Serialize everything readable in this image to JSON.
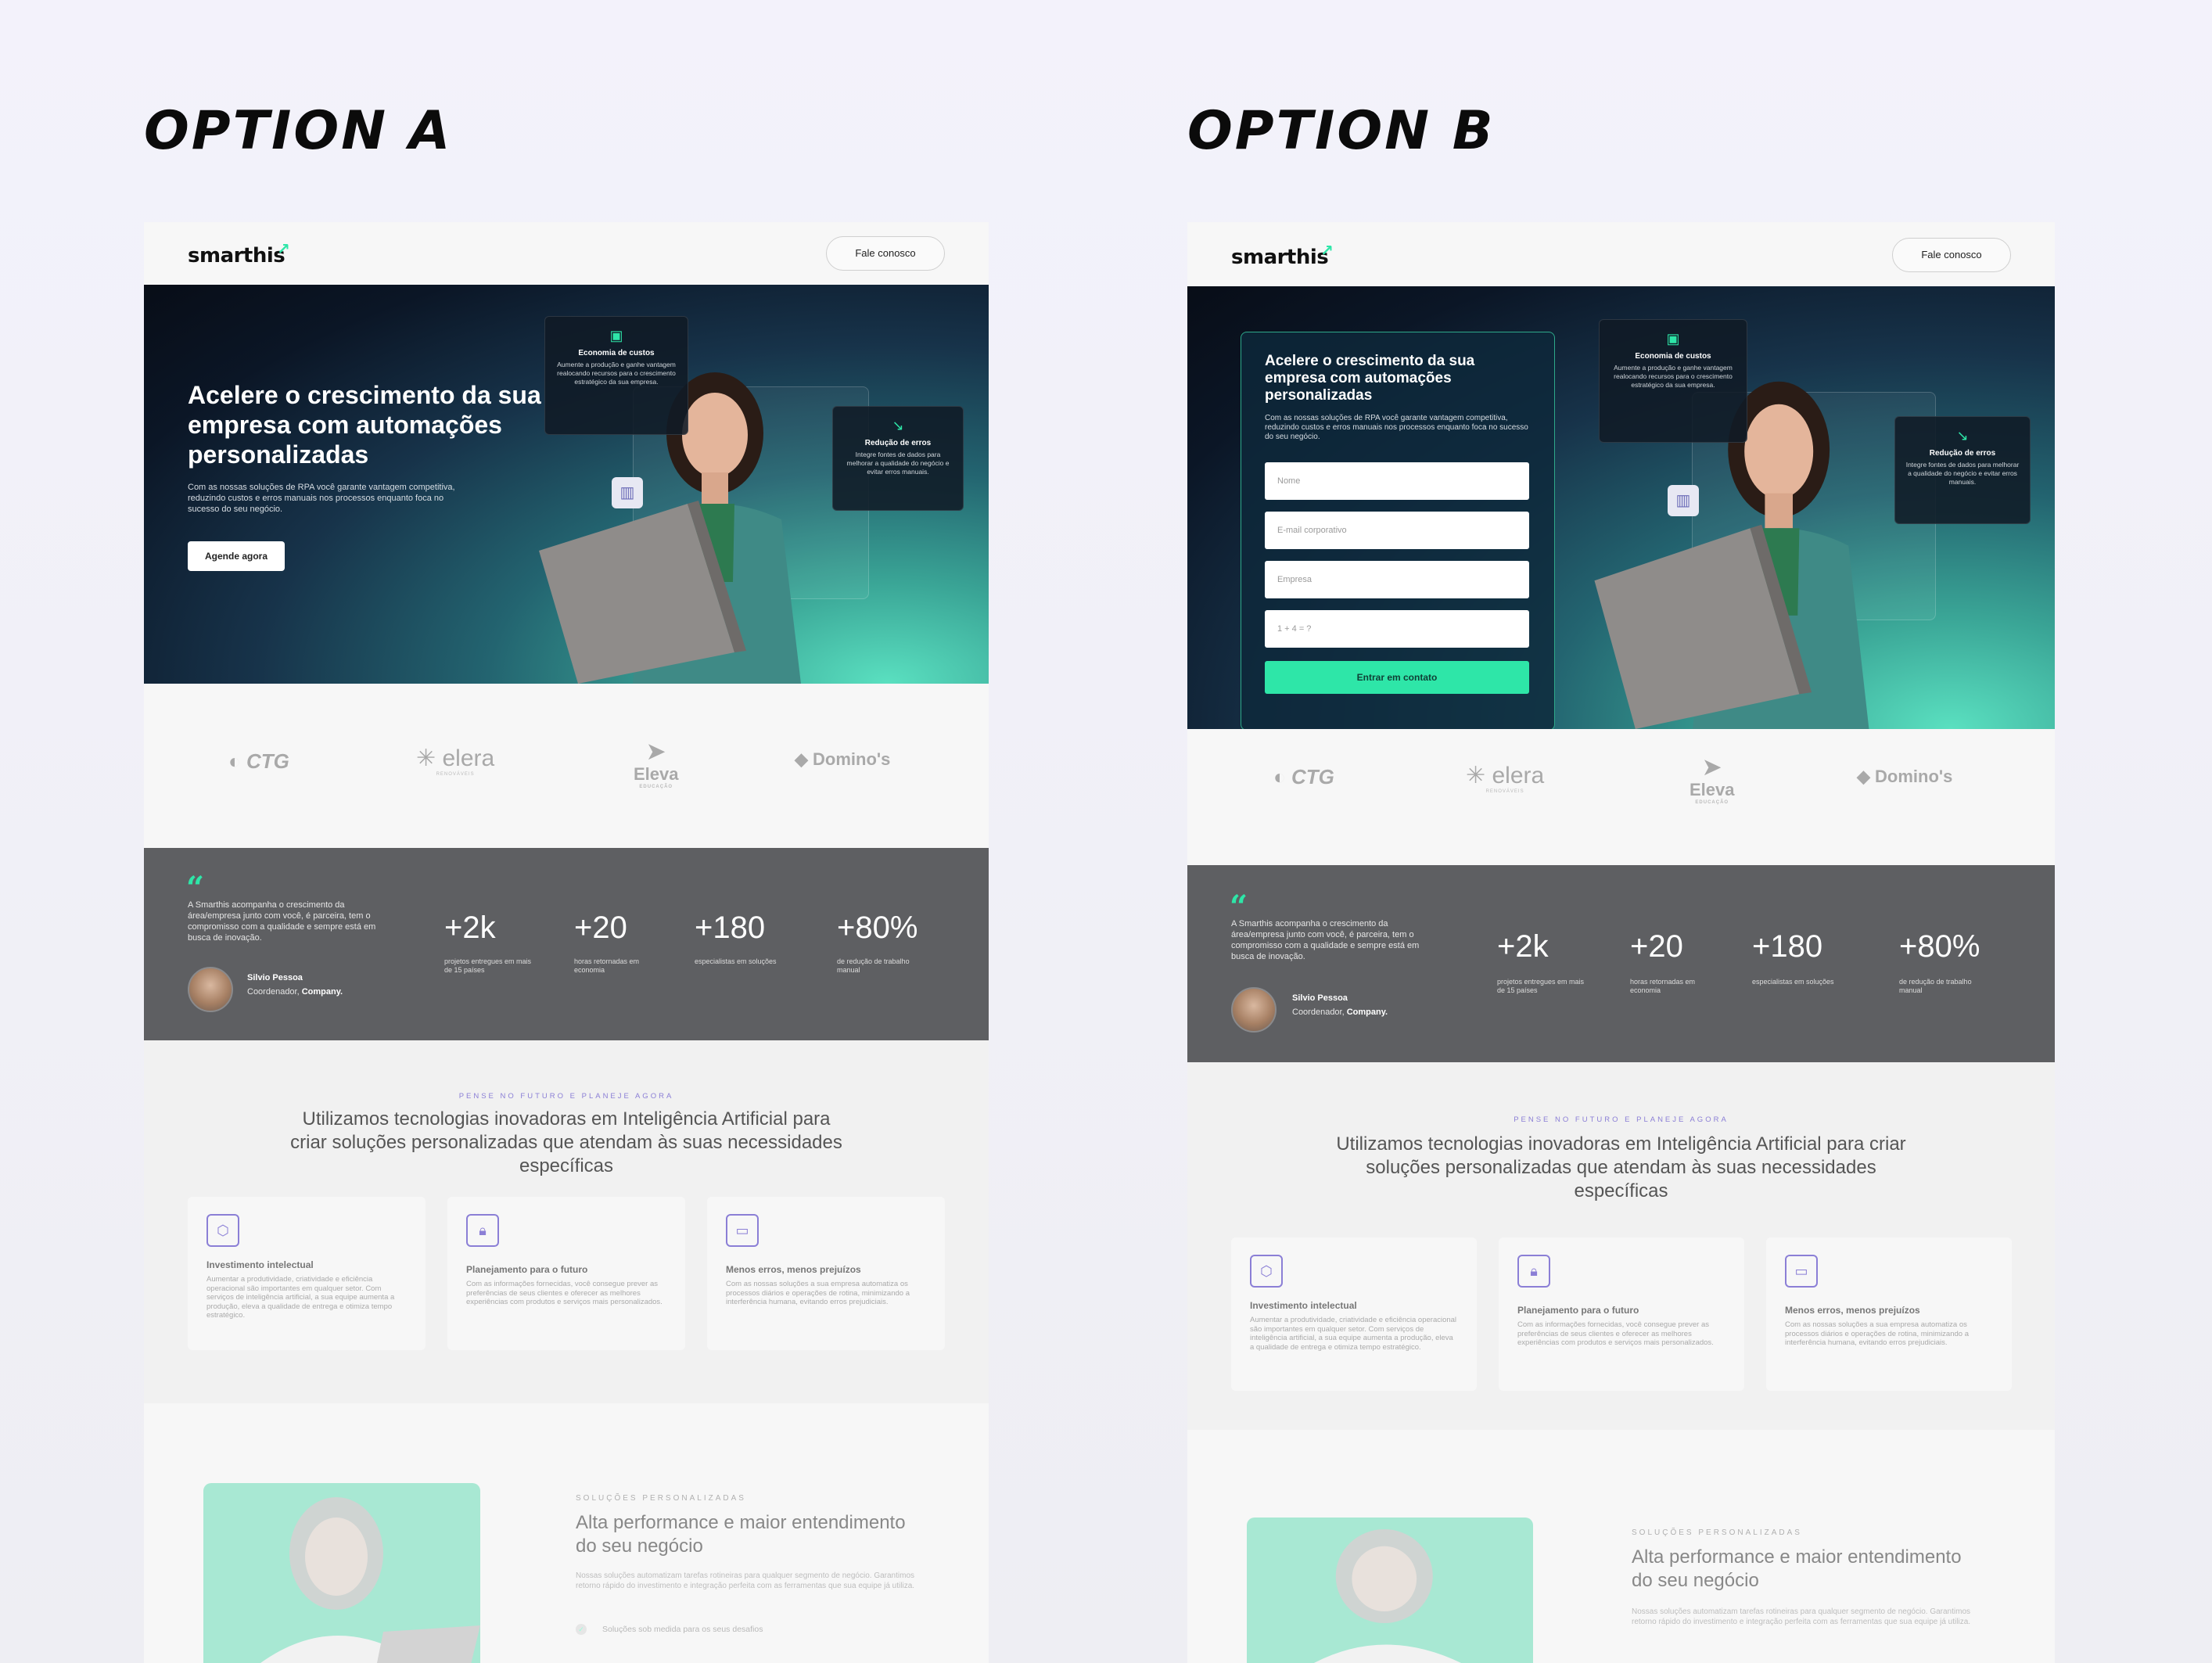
{
  "options": {
    "a_title": "OPTION A",
    "b_title": "OPTION B"
  },
  "nav": {
    "logo": "smarthis",
    "logo_mark": "↗",
    "cta": "Fale conosco"
  },
  "hero": {
    "title": "Acelere o crescimento da sua empresa com automações personalizadas",
    "subtitle": "Com as nossas soluções de RPA você garante vantagem competitiva, reduzindo custos e erros manuais nos processos enquanto foca no sucesso do seu negócio.",
    "cta": "Agende agora",
    "card1": {
      "title": "Economia de custos",
      "desc": "Aumente a produção e ganhe vantagem realocando recursos para o crescimento estratégico da sua empresa."
    },
    "card2": {
      "title": "Redução de erros",
      "desc": "Integre fontes de dados para melhorar a qualidade do negócio e evitar erros manuais."
    }
  },
  "form": {
    "fields": [
      "Nome",
      "E-mail corporativo",
      "Empresa",
      "1 + 4 = ?"
    ],
    "submit": "Entrar em contato"
  },
  "clients": [
    {
      "name": "CTG",
      "sub": ""
    },
    {
      "name": "elera",
      "sub": "RENOVÁVEIS"
    },
    {
      "name": "Eleva",
      "sub": "EDUCAÇÃO"
    },
    {
      "name": "Domino's",
      "sub": ""
    }
  ],
  "testimonial": {
    "quote_mark": "“",
    "text": "A Smarthis acompanha o crescimento da área/empresa junto com você, é parceira, tem o compromisso com a qualidade e sempre está em busca de inovação.",
    "name": "Silvio Pessoa",
    "role": "Coordenador,",
    "company": "Company."
  },
  "stats": [
    {
      "value": "+2k",
      "label": "projetos entregues em mais de 15 países"
    },
    {
      "value": "+20",
      "label": "horas retornadas em economia"
    },
    {
      "value": "+180",
      "label": "especialistas em soluções"
    },
    {
      "value": "+80%",
      "label": "de redução de trabalho manual"
    }
  ],
  "features": {
    "kicker": "PENSE NO FUTURO E PLANEJE AGORA",
    "title": "Utilizamos tecnologias inovadoras em Inteligência Artificial para criar soluções personalizadas que atendam às suas necessidades específicas",
    "cards": [
      {
        "icon": "cube-icon",
        "title": "Investimento intelectual",
        "desc": "Aumentar a produtividade, criatividade e eficiência operacional são importantes em qualquer setor. Com serviços de inteligência artificial, a sua equipe aumenta a produção, eleva a qualidade de entrega e otimiza tempo estratégico."
      },
      {
        "icon": "lock-icon",
        "title": "Planejamento para o futuro",
        "desc": "Com as informações fornecidas, você consegue prever as preferências de seus clientes e oferecer as melhores experiências com produtos e serviços mais personalizados."
      },
      {
        "icon": "monitor-icon",
        "title": "Menos erros, menos prejuízos",
        "desc": "Com as nossas soluções a sua empresa automatiza os processos diários e operações de rotina, minimizando a interferência humana, evitando erros prejudiciais."
      }
    ]
  },
  "solutions": {
    "kicker": "SOLUÇÕES PERSONALIZADAS",
    "title": "Alta performance e maior entendimento do seu negócio",
    "desc": "Nossas soluções automatizam tarefas rotineiras para qualquer segmento de negócio. Garantimos retorno rápido do investimento e integração perfeita com as ferramentas que sua equipe já utiliza.",
    "item": "Soluções sob medida para os seus desafios"
  },
  "colors": {
    "accent": "#2ee6a8",
    "purple": "#8b7fd6",
    "stats_bg": "#5e5f62"
  }
}
